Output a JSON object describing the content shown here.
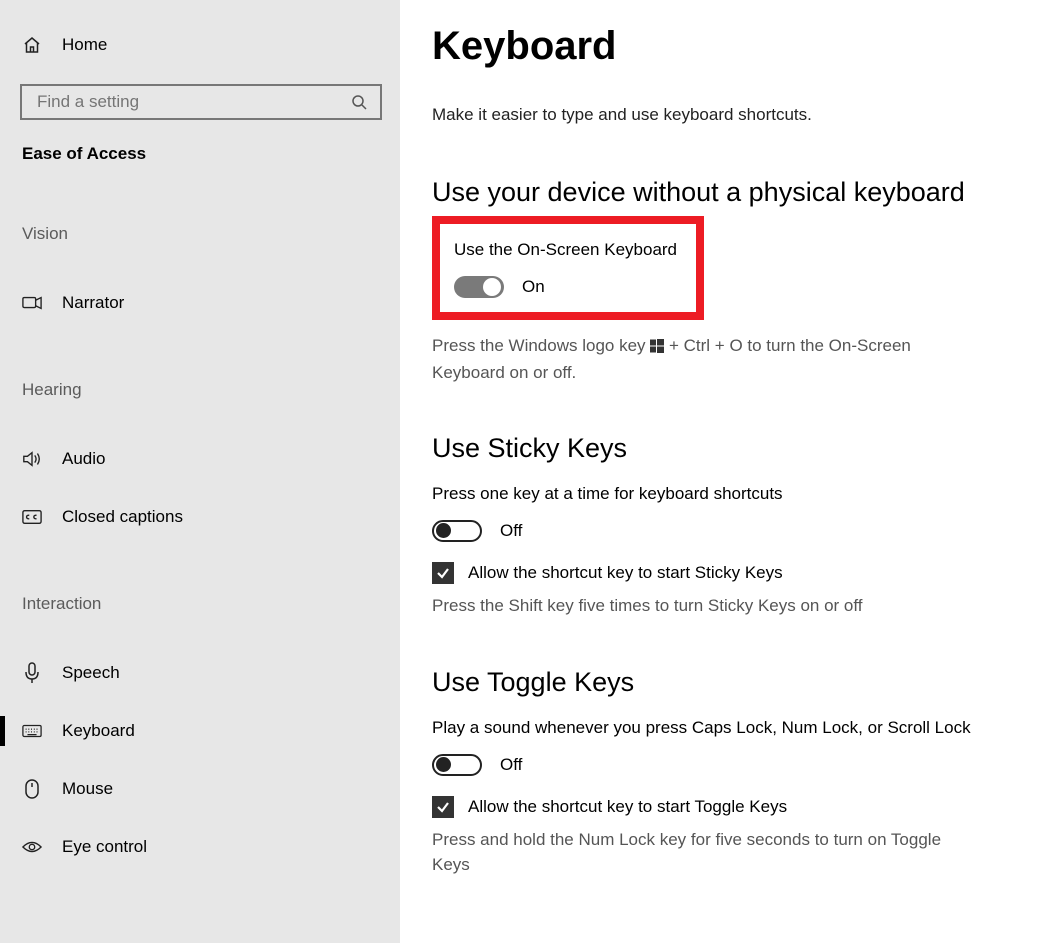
{
  "sidebar": {
    "home": "Home",
    "search_placeholder": "Find a setting",
    "heading": "Ease of Access",
    "groups": [
      {
        "label": "Vision",
        "items": [
          {
            "id": "narrator",
            "label": "Narrator"
          }
        ]
      },
      {
        "label": "Hearing",
        "items": [
          {
            "id": "audio",
            "label": "Audio"
          },
          {
            "id": "captions",
            "label": "Closed captions"
          }
        ]
      },
      {
        "label": "Interaction",
        "items": [
          {
            "id": "speech",
            "label": "Speech"
          },
          {
            "id": "keyboard",
            "label": "Keyboard",
            "active": true
          },
          {
            "id": "mouse",
            "label": "Mouse"
          },
          {
            "id": "eyecontrol",
            "label": "Eye control"
          }
        ]
      }
    ]
  },
  "main": {
    "title": "Keyboard",
    "subtitle": "Make it easier to type and use keyboard shortcuts.",
    "osk": {
      "heading": "Use your device without a physical keyboard",
      "label": "Use the On-Screen Keyboard",
      "state": "On",
      "hint_pre": "Press the Windows logo key ",
      "hint_post": " + Ctrl + O to turn the On-Screen Keyboard on or off."
    },
    "sticky": {
      "heading": "Use Sticky Keys",
      "body": "Press one key at a time for keyboard shortcuts",
      "state": "Off",
      "chk": "Allow the shortcut key to start Sticky Keys",
      "hint": "Press the Shift key five times to turn Sticky Keys on or off"
    },
    "togglek": {
      "heading": "Use Toggle Keys",
      "body": "Play a sound whenever you press Caps Lock, Num Lock, or Scroll Lock",
      "state": "Off",
      "chk": "Allow the shortcut key to start Toggle Keys",
      "hint": "Press and hold the Num Lock key for five seconds to turn on Toggle Keys"
    }
  }
}
